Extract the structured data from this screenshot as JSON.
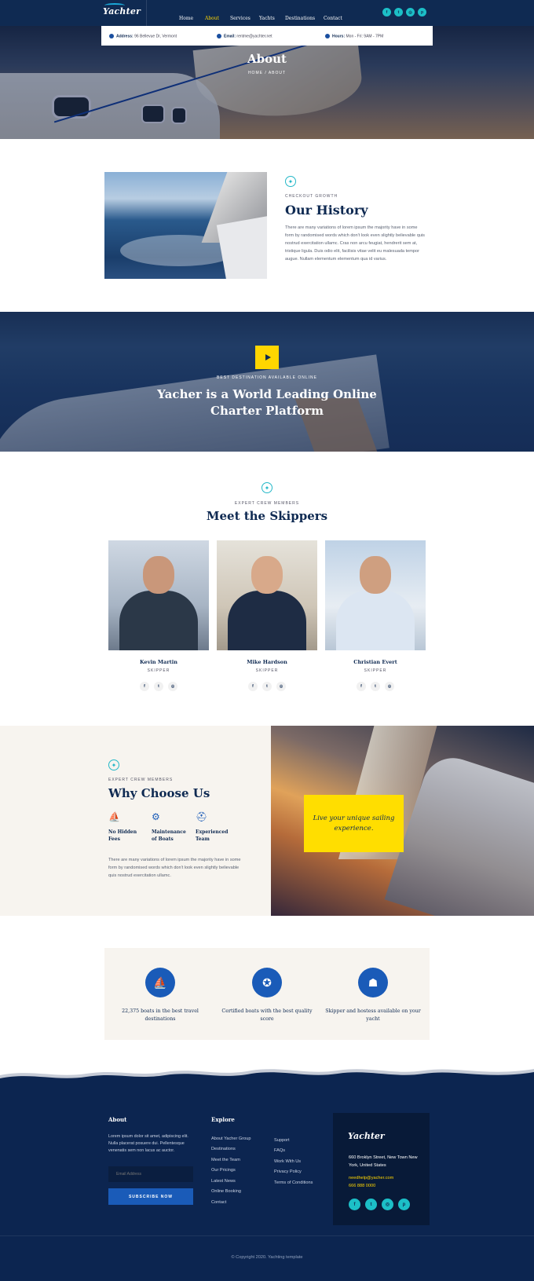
{
  "header": {
    "logo": "Yachter",
    "nav": [
      "Home",
      "About",
      "Services",
      "Yachts",
      "Destinations",
      "Contact"
    ],
    "active_nav": "About",
    "socials": [
      "facebook-icon",
      "twitter-icon",
      "instagram-icon",
      "pinterest-icon"
    ]
  },
  "info_bar": {
    "address_label": "Address:",
    "address": "96 Bellevue Dr, Vermont",
    "email_label": "Email:",
    "email": "rentme@yachter.net",
    "hours_label": "Hours:",
    "hours": "Mon - Fri: 9AM - 7PM"
  },
  "hero": {
    "title": "About",
    "breadcrumb": "HOME / ABOUT"
  },
  "history": {
    "eyebrow": "CHECKOUT GROWTH",
    "title": "Our History",
    "text": "There are many variations of lorem ipsum the majority have in some form by randomised words which don't look even slightly believable quis nostrud exercitation ullamc. Cras non arcu feugiat, hendrerit sem at, tristique ligula. Duis odio elit, facilisis vitae velit eu malesuada tempor augue. Nullam elementum elementum qua id varius."
  },
  "band": {
    "eyebrow": "BEST DESTINATION AVAILABLE ONLINE",
    "title": "Yacher is a World Leading Online Charter Platform"
  },
  "skippers": {
    "eyebrow": "EXPERT CREW MEMBERS",
    "title": "Meet the Skippers",
    "members": [
      {
        "name": "Kevin Martin",
        "role": "SKIPPER"
      },
      {
        "name": "Mike Hardson",
        "role": "SKIPPER"
      },
      {
        "name": "Christian Evert",
        "role": "SKIPPER"
      }
    ]
  },
  "why": {
    "eyebrow": "EXPERT CREW MEMBERS",
    "title": "Why Choose Us",
    "features": [
      "No Hidden Fees",
      "Maintenance of Boats",
      "Experienced Team"
    ],
    "text": "There are many variations of lorem ipsum the majority have in some form by randomised words which don't look even slightly believable quis nostrud exercitation ullamc.",
    "quote": "Live your unique sailing experience."
  },
  "stats": [
    {
      "label": "22,375 boats in the best travel destinations",
      "icon": "sailboat-icon"
    },
    {
      "label": "Certified boats with the best quality score",
      "icon": "medal-icon"
    },
    {
      "label": "Skipper and hostess available on your yacht",
      "icon": "uniform-icon"
    }
  ],
  "footer": {
    "about_title": "About",
    "about_text": "Lorem ipsum dolor sit amet, adipiscing elit. Nulla placerat posuere dui. Pellentesque venenatis sem non lacus ac auctor.",
    "email_placeholder": "Email Address",
    "subscribe": "SUBSCRIBE NOW",
    "explore_title": "Explore",
    "explore_col1": [
      "About Yacher Group",
      "Destinations",
      "Meet the Team",
      "Our Pricings",
      "Latest News",
      "Online Booking",
      "Contact"
    ],
    "explore_col2": [
      "Support",
      "FAQs",
      "Work With Us",
      "Privacy Policy",
      "Terms of Conditions"
    ],
    "card_logo": "Yachter",
    "card_address": "660 Broklyn Street, New Town New York, United States",
    "card_email": "needhelp@yacher.com",
    "card_phone": "666 888 0000",
    "copyright": "© Copyright 2020. Yachting template"
  },
  "colors": {
    "navy": "#0f2a52",
    "teal": "#1cbfc7",
    "yellow": "#ffd600",
    "blue": "#1a5bb8",
    "cream": "#f7f4ef"
  }
}
